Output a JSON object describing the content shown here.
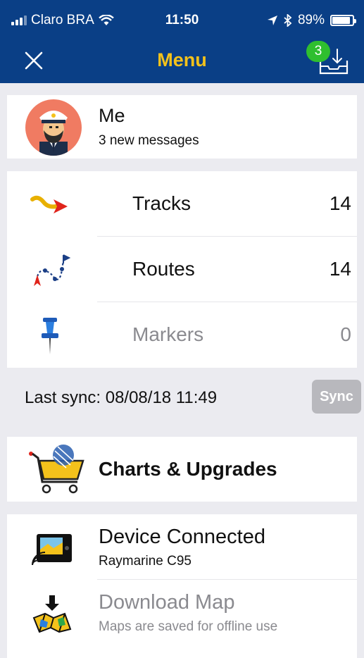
{
  "status_bar": {
    "carrier": "Claro BRA",
    "time": "11:50",
    "battery": "89%",
    "battery_level": 0.89,
    "icons": [
      "signal-icon",
      "wifi-icon",
      "location-arrow-icon",
      "bluetooth-icon",
      "battery-icon"
    ]
  },
  "nav": {
    "title": "Menu",
    "title_color": "#f4c21b",
    "bar_color": "#0a3f86",
    "inbox_badge": "3",
    "badge_color": "#2fbf2f",
    "icons": [
      "close-icon",
      "inbox-download-icon"
    ]
  },
  "profile": {
    "name": "Me",
    "subtitle": "3 new messages",
    "icon": "captain-avatar-icon"
  },
  "items": [
    {
      "label": "Tracks",
      "count": "14",
      "icon": "track-arrow-icon",
      "enabled": true
    },
    {
      "label": "Routes",
      "count": "14",
      "icon": "route-icon",
      "enabled": true
    },
    {
      "label": "Markers",
      "count": "0",
      "icon": "pushpin-icon",
      "enabled": false
    }
  ],
  "sync": {
    "text": "Last sync: 08/08/18 11:49",
    "button": "Sync"
  },
  "charts": {
    "label": "Charts & Upgrades",
    "icon": "shopping-cart-chart-icon"
  },
  "device": {
    "label": "Device Connected",
    "subtitle": "Raymarine C95",
    "icon": "cast-device-icon"
  },
  "download": {
    "label": "Download Map",
    "subtitle": "Maps are saved for offline use",
    "icon": "download-map-icon"
  }
}
